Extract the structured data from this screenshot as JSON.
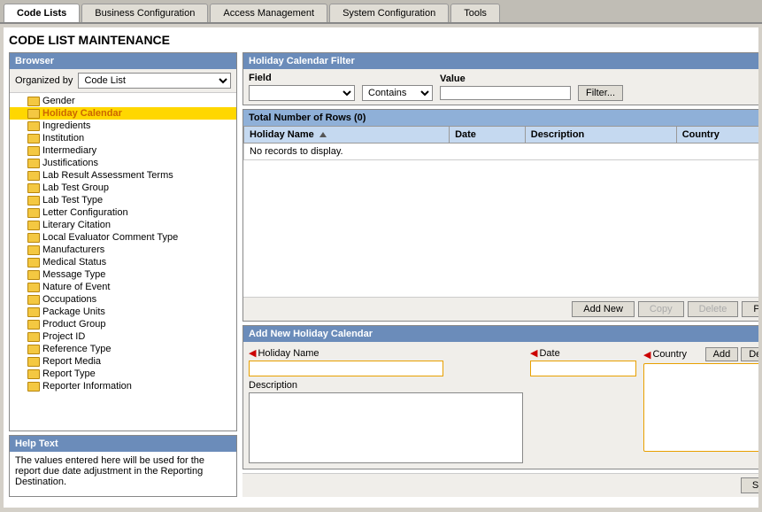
{
  "nav": {
    "tabs": [
      {
        "id": "code-lists",
        "label": "Code Lists",
        "active": true
      },
      {
        "id": "business-config",
        "label": "Business Configuration",
        "active": false
      },
      {
        "id": "access-management",
        "label": "Access Management",
        "active": false
      },
      {
        "id": "system-config",
        "label": "System Configuration",
        "active": false
      },
      {
        "id": "tools",
        "label": "Tools",
        "active": false
      }
    ]
  },
  "page": {
    "title": "CODE LIST MAINTENANCE"
  },
  "browser": {
    "header": "Browser",
    "organized_by_label": "Organized by",
    "organized_by_value": "Code List",
    "tree_items": [
      {
        "label": "Gender",
        "selected": false
      },
      {
        "label": "Holiday Calendar",
        "selected": true
      },
      {
        "label": "Ingredients",
        "selected": false
      },
      {
        "label": "Institution",
        "selected": false
      },
      {
        "label": "Intermediary",
        "selected": false
      },
      {
        "label": "Justifications",
        "selected": false
      },
      {
        "label": "Lab Result Assessment Terms",
        "selected": false
      },
      {
        "label": "Lab Test Group",
        "selected": false
      },
      {
        "label": "Lab Test Type",
        "selected": false
      },
      {
        "label": "Letter Configuration",
        "selected": false
      },
      {
        "label": "Literary Citation",
        "selected": false
      },
      {
        "label": "Local Evaluator Comment Type",
        "selected": false
      },
      {
        "label": "Manufacturers",
        "selected": false
      },
      {
        "label": "Medical Status",
        "selected": false
      },
      {
        "label": "Message Type",
        "selected": false
      },
      {
        "label": "Nature of Event",
        "selected": false
      },
      {
        "label": "Occupations",
        "selected": false
      },
      {
        "label": "Package Units",
        "selected": false
      },
      {
        "label": "Product Group",
        "selected": false
      },
      {
        "label": "Project ID",
        "selected": false
      },
      {
        "label": "Reference Type",
        "selected": false
      },
      {
        "label": "Report Media",
        "selected": false
      },
      {
        "label": "Report Type",
        "selected": false
      },
      {
        "label": "Reporter Information",
        "selected": false
      }
    ]
  },
  "help": {
    "header": "Help Text",
    "body": "The values entered here will be used for the report due date adjustment in the Reporting Destination."
  },
  "filter": {
    "header": "Holiday Calendar Filter",
    "field_label": "Field",
    "contains_label": "Contains",
    "value_label": "Value",
    "filter_btn": "Filter..."
  },
  "table": {
    "title": "Total Number of Rows (0)",
    "columns": [
      "Holiday Name",
      "Date",
      "Description",
      "Country"
    ],
    "no_data": "No records to display.",
    "buttons": {
      "add_new": "Add New",
      "copy": "Copy",
      "delete": "Delete",
      "print": "Print"
    }
  },
  "add_section": {
    "header": "Add New Holiday Calendar",
    "holiday_name_label": "Holiday Name",
    "date_label": "Date",
    "description_label": "Description",
    "country_label": "Country",
    "add_btn": "Add",
    "delete_btn": "Delete",
    "save_btn": "Save"
  }
}
